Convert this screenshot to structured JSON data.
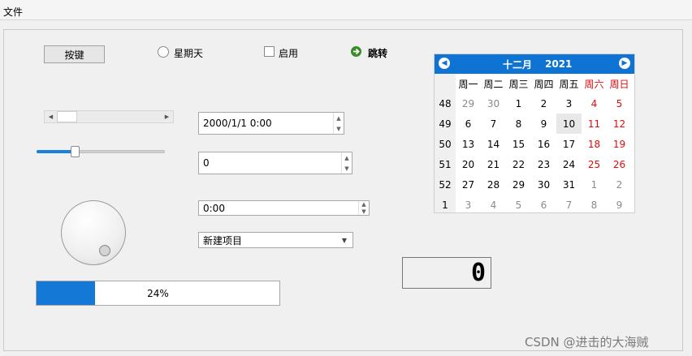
{
  "menubar": {
    "file_label": "文件"
  },
  "controls": {
    "push_button_label": "按键",
    "radio_label": "星期天",
    "checkbox_label": "启用",
    "command_link_label": "跳转",
    "slider_value": 0.3,
    "progress_value": 0.24,
    "progress_text": "24%",
    "datetime_value": "2000/1/1 0:00",
    "int_spin_value": "0",
    "time_value": "0:00",
    "combo_value": "新建项目",
    "lcd_value": "0"
  },
  "calendar": {
    "month": "十二月",
    "year": "2021",
    "weekday_headers": [
      "周一",
      "周二",
      "周三",
      "周四",
      "周五",
      "周六",
      "周日"
    ],
    "week_numbers": [
      "48",
      "49",
      "50",
      "51",
      "52",
      "1"
    ],
    "days": [
      [
        "29",
        "30",
        "1",
        "2",
        "3",
        "4",
        "5"
      ],
      [
        "6",
        "7",
        "8",
        "9",
        "10",
        "11",
        "12"
      ],
      [
        "13",
        "14",
        "15",
        "16",
        "17",
        "18",
        "19"
      ],
      [
        "20",
        "21",
        "22",
        "23",
        "24",
        "25",
        "26"
      ],
      [
        "27",
        "28",
        "29",
        "30",
        "31",
        "1",
        "2"
      ],
      [
        "3",
        "4",
        "5",
        "6",
        "7",
        "8",
        "9"
      ]
    ],
    "other_month_mask": [
      [
        true,
        true,
        false,
        false,
        false,
        false,
        false
      ],
      [
        false,
        false,
        false,
        false,
        false,
        false,
        false
      ],
      [
        false,
        false,
        false,
        false,
        false,
        false,
        false
      ],
      [
        false,
        false,
        false,
        false,
        false,
        false,
        false
      ],
      [
        false,
        false,
        false,
        false,
        false,
        true,
        true
      ],
      [
        true,
        true,
        true,
        true,
        true,
        true,
        true
      ]
    ],
    "selected_day": "10",
    "weekend_color": "#e20b0b",
    "header_color": "#0f73d4"
  },
  "watermark": "CSDN @进击的大海贼"
}
